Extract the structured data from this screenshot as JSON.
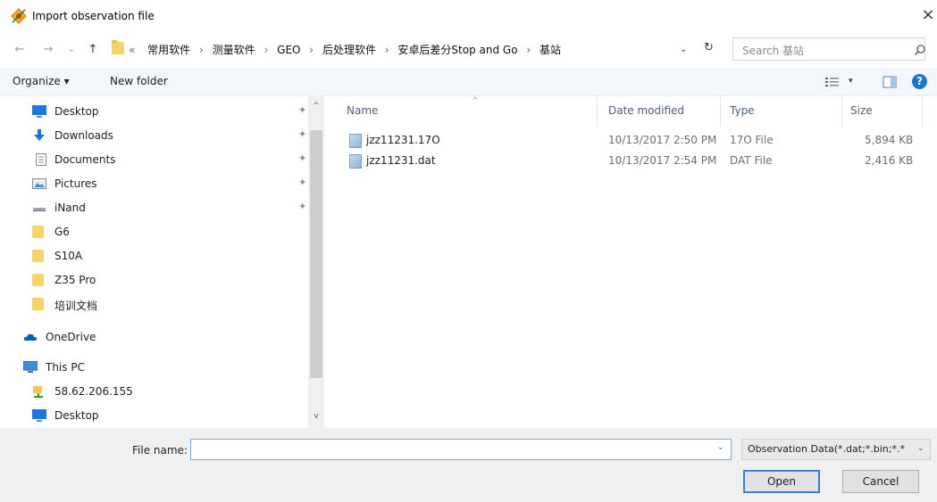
{
  "window": {
    "title": "Import observation file",
    "close_glyph": "×"
  },
  "nav": {
    "back_glyph": "←",
    "forward_glyph": "→",
    "recent_glyph": "⌄",
    "up_glyph": "↑",
    "overflow_glyph": "«",
    "breadcrumb": [
      "常用软件",
      "测量软件",
      "GEO",
      "后处理软件",
      "安卓后差分Stop and Go",
      "基站"
    ],
    "breadcrumb_sep": "›",
    "search_placeholder": "Search 基站",
    "refresh_glyph": "↻",
    "dropdown_glyph": "⌄"
  },
  "toolbar": {
    "organize_label": "Organize ▾",
    "new_folder_label": "New folder",
    "view_drop_glyph": "▾",
    "help_glyph": "?"
  },
  "sidebar": {
    "items": [
      {
        "label": "Desktop",
        "icon": "desktop-icon",
        "pinned": true
      },
      {
        "label": "Downloads",
        "icon": "downloads-icon",
        "pinned": true
      },
      {
        "label": "Documents",
        "icon": "documents-icon",
        "pinned": true
      },
      {
        "label": "Pictures",
        "icon": "pictures-icon",
        "pinned": true
      },
      {
        "label": "iNand",
        "icon": "drive-icon",
        "pinned": true
      },
      {
        "label": "G6",
        "icon": "folder-icon"
      },
      {
        "label": "S10A",
        "icon": "folder-icon"
      },
      {
        "label": "Z35 Pro",
        "icon": "folder-icon"
      },
      {
        "label": "培训文档",
        "icon": "folder-icon"
      },
      {
        "label": "OneDrive",
        "icon": "onedrive-icon"
      },
      {
        "label": "This PC",
        "icon": "pc-icon"
      },
      {
        "label": "58.62.206.155",
        "icon": "network-drive-icon"
      },
      {
        "label": "Desktop",
        "icon": "desktop-icon"
      }
    ],
    "pin_glyph": "✦",
    "scroll_up_glyph": "^",
    "scroll_down_glyph": "v"
  },
  "filelist": {
    "columns": {
      "name": "Name",
      "date": "Date modified",
      "type": "Type",
      "size": "Size"
    },
    "sort_glyph": "^",
    "rows": [
      {
        "name": "jzz11231.17O",
        "date": "10/13/2017 2:50 PM",
        "type": "17O File",
        "size": "5,894 KB"
      },
      {
        "name": "jzz11231.dat",
        "date": "10/13/2017 2:54 PM",
        "type": "DAT File",
        "size": "2,416 KB"
      }
    ]
  },
  "bottom": {
    "file_name_label": "File name:",
    "file_name_value": "",
    "filter_value": "Observation Data(*.dat;*.bin;*.*",
    "dropdown_glyph": "⌄",
    "open_label": "Open",
    "cancel_label": "Cancel"
  },
  "colors": {
    "accent": "#3c7fd9",
    "folder": "#f7d46a",
    "help": "#1e73d2",
    "toolbar_bg": "#f3f6fb"
  }
}
